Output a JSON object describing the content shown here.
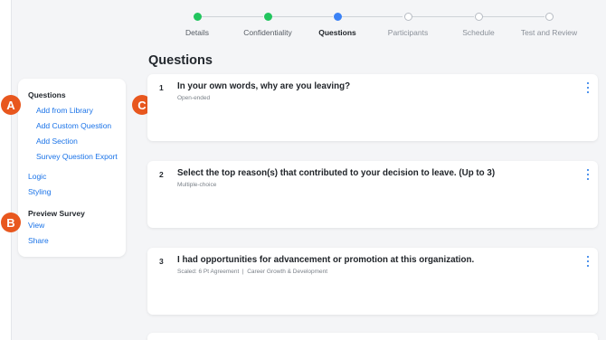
{
  "stepper": {
    "steps": [
      {
        "label": "Details",
        "state": "done"
      },
      {
        "label": "Confidentiality",
        "state": "done"
      },
      {
        "label": "Questions",
        "state": "current"
      },
      {
        "label": "Participants",
        "state": "todo"
      },
      {
        "label": "Schedule",
        "state": "todo"
      },
      {
        "label": "Test and Review",
        "state": "todo"
      }
    ]
  },
  "page_title": "Questions",
  "sidebar": {
    "questions_heading": "Questions",
    "add_from_library": "Add from Library",
    "add_custom_question": "Add Custom Question",
    "add_section": "Add Section",
    "survey_question_export": "Survey Question Export",
    "logic": "Logic",
    "styling": "Styling",
    "preview_heading": "Preview Survey",
    "view": "View",
    "share": "Share"
  },
  "badges": {
    "a": "A",
    "b": "B",
    "c": "C"
  },
  "questions": [
    {
      "number": "1",
      "title": "In your own words, why are you leaving?",
      "type": "Open-ended"
    },
    {
      "number": "2",
      "title": "Select the top reason(s) that contributed to your decision to leave. (Up to 3)",
      "type": "Multiple-choice"
    },
    {
      "number": "3",
      "title": "I had opportunities for advancement or promotion at this organization.",
      "type": "Scaled: 6 Pt Agreement  |  Career Growth & Development"
    }
  ],
  "colors": {
    "accent": "#1a73e8",
    "done": "#22c55e",
    "current": "#3b82f6",
    "badge": "#e8571e"
  },
  "icons": {
    "card_menu": "kebab-menu-icon"
  }
}
